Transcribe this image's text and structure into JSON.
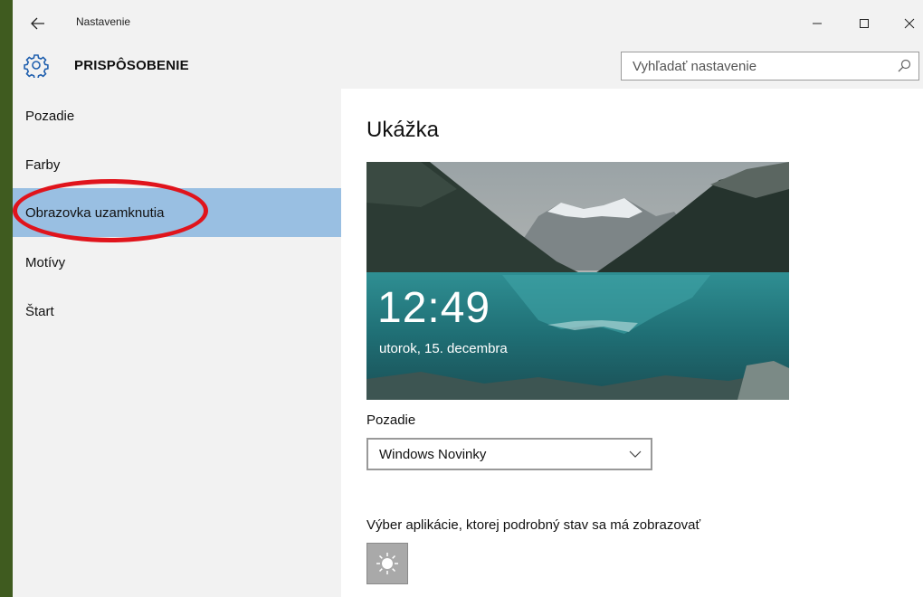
{
  "window": {
    "title": "Nastavenie"
  },
  "header": {
    "heading": "PRISPÔSOBENIE",
    "search_placeholder": "Vyhľadať nastavenie",
    "search_value": ""
  },
  "sidebar": {
    "items": [
      {
        "label": "Pozadie",
        "active": false
      },
      {
        "label": "Farby",
        "active": false
      },
      {
        "label": "Obrazovka uzamknutia",
        "active": true
      },
      {
        "label": "Motívy",
        "active": false
      },
      {
        "label": "Štart",
        "active": false
      }
    ],
    "highlight_color": "#99bfe2",
    "annotation_color": "#e0141c"
  },
  "content": {
    "preview_title": "Ukážka",
    "lock_time": "12:49",
    "lock_date": "utorok, 15. decembra",
    "background_label": "Pozadie",
    "background_value": "Windows Novinky",
    "app_status_label": "Výber aplikácie, ktorej podrobný stav sa má zobrazovať",
    "app_tile_icon": "brightness-icon"
  }
}
